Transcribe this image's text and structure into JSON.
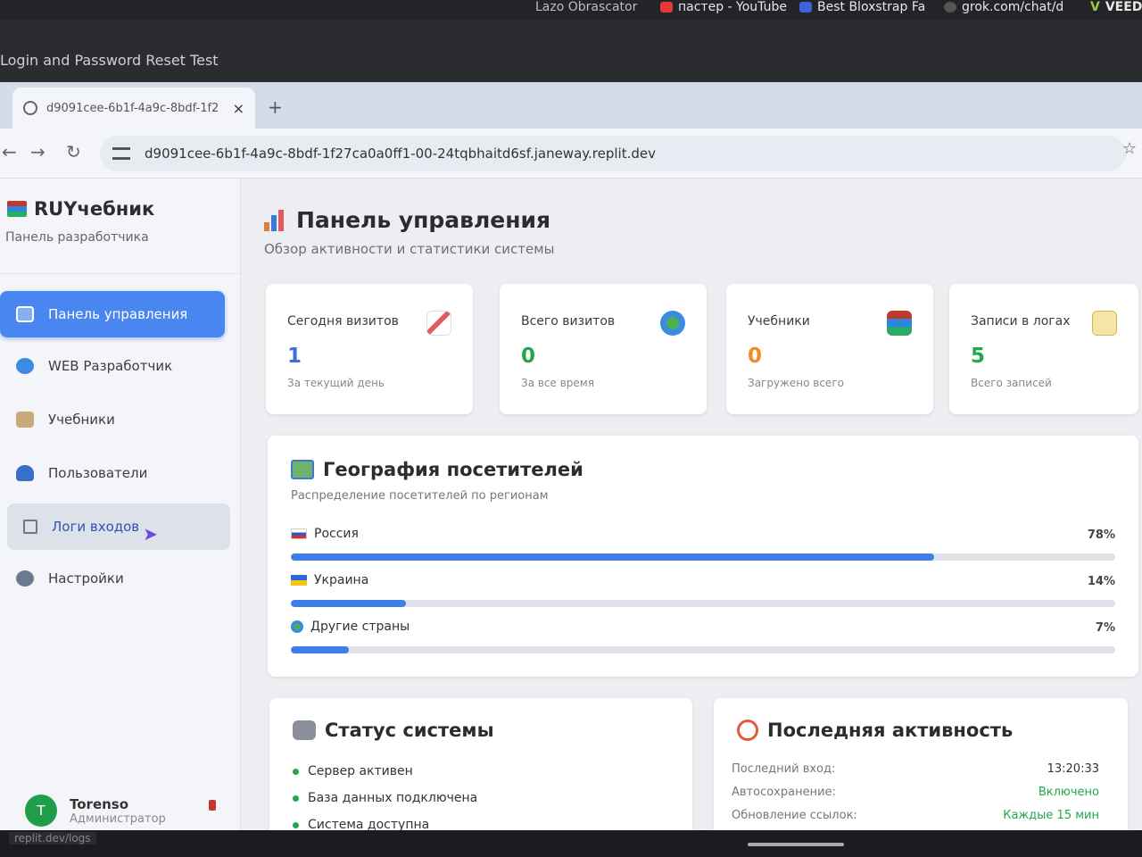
{
  "bookmarks": [
    {
      "label": "Lazo Obrascator",
      "color": "#888888"
    },
    {
      "label": "пастер - YouTube",
      "color": "#e53935"
    },
    {
      "label": "Best Bloxstrap Fa",
      "color": "#3b63d8"
    },
    {
      "label": "grok.com/chat/d",
      "color": "#555555"
    },
    {
      "label": "VEED",
      "color": "#9ccc3c"
    }
  ],
  "window": {
    "title": "Login and Password Reset Test"
  },
  "tab": {
    "title": "d9091cee-6b1f-4a9c-8bdf-1f2",
    "close": "×",
    "new": "+"
  },
  "address": {
    "url": "d9091cee-6b1f-4a9c-8bdf-1f27ca0a0ff1-00-24tqbhaitd6sf.janeway.replit.dev"
  },
  "sidebar": {
    "brand": "RUYчебник",
    "subtitle": "Панель разработчика",
    "items": [
      {
        "label": "Панель управления",
        "icon": "chart-icon"
      },
      {
        "label": "WEB Разработчик",
        "icon": "globe-icon"
      },
      {
        "label": "Учебники",
        "icon": "book-icon"
      },
      {
        "label": "Пользователи",
        "icon": "users-icon"
      },
      {
        "label": "Логи входов",
        "icon": "checkbox-icon"
      },
      {
        "label": "Настройки",
        "icon": "gear-icon"
      }
    ],
    "user": {
      "initial": "T",
      "name": "Torenso",
      "role": "Администратор"
    }
  },
  "main": {
    "title": "Панель управления",
    "subtitle": "Обзор активности и статистики системы",
    "stats": [
      {
        "label": "Сегодня визитов",
        "value": "1",
        "caption": "За текущий день",
        "color": "#3d6fd6",
        "icon": "trend-icon"
      },
      {
        "label": "Всего визитов",
        "value": "0",
        "caption": "За все время",
        "color": "#22a74c",
        "icon": "globe-icon"
      },
      {
        "label": "Учебники",
        "value": "0",
        "caption": "Загружено всего",
        "color": "#f08a24",
        "icon": "books-icon"
      },
      {
        "label": "Записи в логах",
        "value": "5",
        "caption": "Всего записей",
        "color": "#22a74c",
        "icon": "memo-icon"
      }
    ],
    "geo": {
      "title": "География посетителей",
      "subtitle": "Распределение посетителей по регионам",
      "rows": [
        {
          "label": "Россия",
          "percent": "78%",
          "value": 78
        },
        {
          "label": "Украина",
          "percent": "14%",
          "value": 14
        },
        {
          "label": "Другие страны",
          "percent": "7%",
          "value": 7
        }
      ]
    },
    "status": {
      "title": "Статус системы",
      "items": [
        "Сервер активен",
        "База данных подключена",
        "Система доступна"
      ]
    },
    "activity": {
      "title": "Последняя активность",
      "rows": [
        {
          "key": "Последний вход:",
          "value": "13:20:33",
          "color": "#333333"
        },
        {
          "key": "Автосохранение:",
          "value": "Включено",
          "color": "#22a74c"
        },
        {
          "key": "Обновление ссылок:",
          "value": "Каждые 15 мин",
          "color": "#22a74c"
        }
      ]
    }
  },
  "statusbar": {
    "url": "replit.dev/logs"
  }
}
